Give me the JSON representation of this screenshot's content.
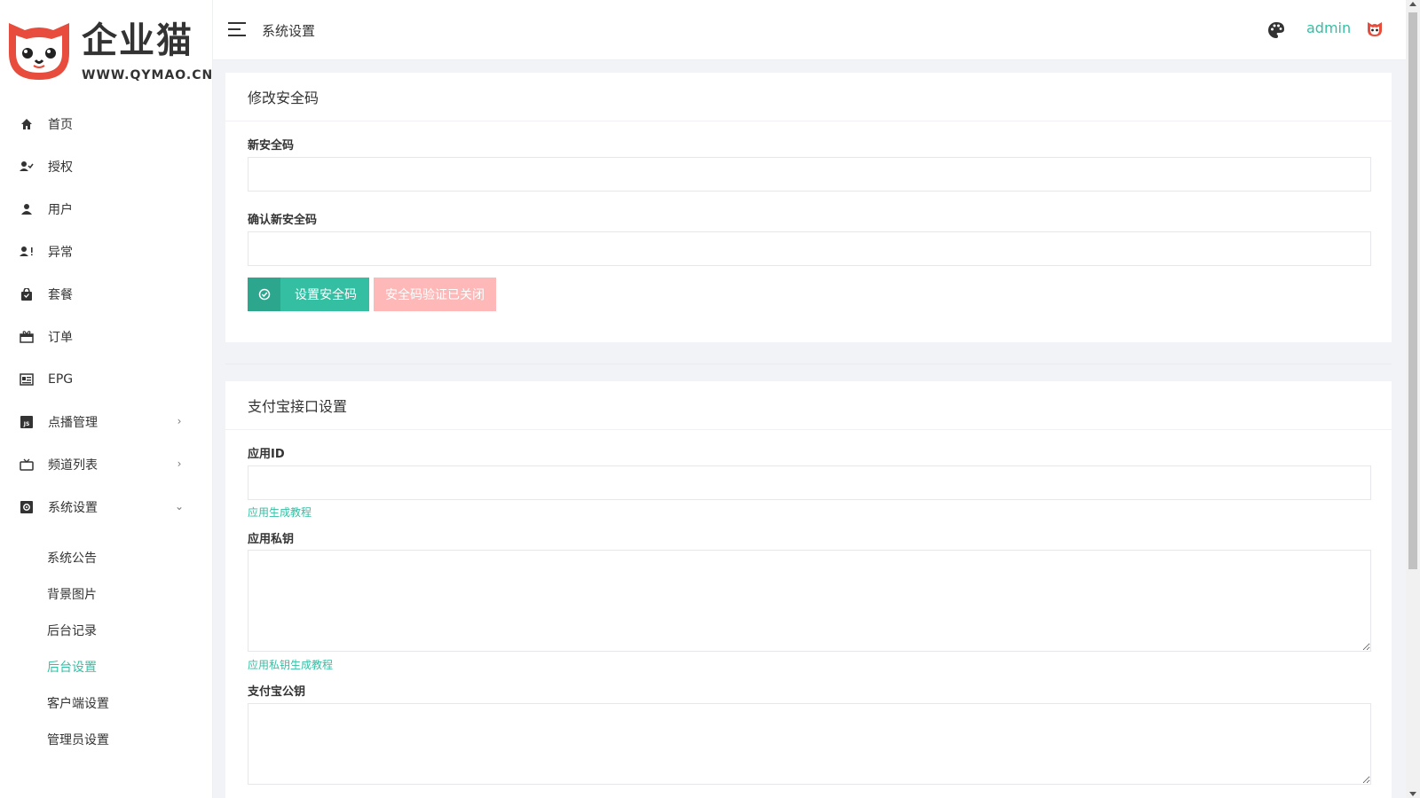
{
  "brand": {
    "name": "企业猫",
    "url": "WWW.QYMAO.CN"
  },
  "sidebar": {
    "items": [
      {
        "label": "首页",
        "icon": "home-icon"
      },
      {
        "label": "授权",
        "icon": "user-check-icon"
      },
      {
        "label": "用户",
        "icon": "user-icon"
      },
      {
        "label": "异常",
        "icon": "user-alert-icon"
      },
      {
        "label": "套餐",
        "icon": "shopping-bag-icon"
      },
      {
        "label": "订单",
        "icon": "gift-icon"
      },
      {
        "label": "EPG",
        "icon": "list-icon"
      },
      {
        "label": "点播管理",
        "icon": "js-icon"
      },
      {
        "label": "频道列表",
        "icon": "tv-icon"
      },
      {
        "label": "系统设置",
        "icon": "settings-icon"
      }
    ],
    "sub_items": [
      "系统公告",
      "背景图片",
      "后台记录",
      "后台设置",
      "客户端设置",
      "管理员设置"
    ],
    "active_sub": "后台设置"
  },
  "topbar": {
    "title": "系统设置",
    "user": "admin"
  },
  "security_card": {
    "title": "修改安全码",
    "new_label": "新安全码",
    "new_value": "",
    "confirm_label": "确认新安全码",
    "confirm_value": "",
    "set_button": "设置安全码",
    "status_button": "安全码验证已关闭"
  },
  "alipay_card": {
    "title": "支付宝接口设置",
    "app_id_label": "应用ID",
    "app_id_value": "",
    "app_id_help": "应用生成教程",
    "private_key_label": "应用私钥",
    "private_key_value": "",
    "private_key_help": "应用私钥生成教程",
    "public_key_label": "支付宝公钥",
    "public_key_value": ""
  },
  "colors": {
    "accent": "#34bfa3",
    "disabled_button": "#ffb8b8",
    "brand_red": "#e74c3c"
  }
}
